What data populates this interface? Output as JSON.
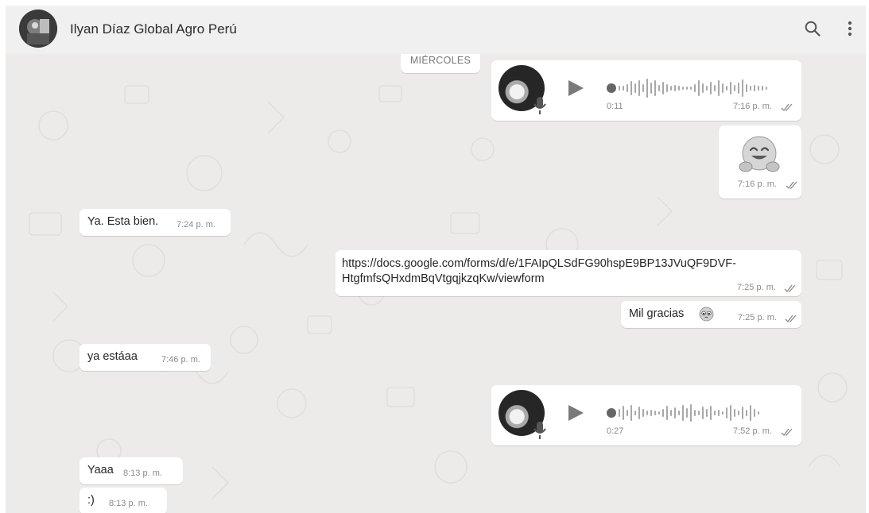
{
  "header": {
    "contact_name": "Ilyan Díaz Global Agro Perú",
    "search_icon": "search-icon",
    "menu_icon": "kebab-menu-icon"
  },
  "chat": {
    "date_separator": "MIÉRCOLES",
    "messages": [
      {
        "type": "voice",
        "direction": "out",
        "duration": "0:11",
        "time": "7:16 p. m.",
        "status": "read"
      },
      {
        "type": "sticker",
        "direction": "out",
        "sticker": "hugging-face-emoji",
        "time": "7:16 p. m.",
        "status": "read"
      },
      {
        "type": "text",
        "direction": "in",
        "text": "Ya. Esta bien.",
        "time": "7:24 p. m."
      },
      {
        "type": "text",
        "direction": "out",
        "text_line1": "https://docs.google.com/forms/d/e/1FAIpQLSdFG90hspE9BP13JVuQF9DVF-",
        "text_line2": "HtgfmfsQHxdmBqVtgqjkzqKw/viewform",
        "time": "7:25 p. m.",
        "status": "read"
      },
      {
        "type": "text",
        "direction": "out",
        "text": "Mil gracias",
        "emoji": "pleading-face-emoji",
        "time": "7:25 p. m.",
        "status": "read"
      },
      {
        "type": "text",
        "direction": "in",
        "text": "ya estáaa",
        "time": "7:46 p. m."
      },
      {
        "type": "voice",
        "direction": "out",
        "duration": "0:27",
        "time": "7:52 p. m.",
        "status": "read"
      },
      {
        "type": "text",
        "direction": "in",
        "text": "Yaaa",
        "time": "8:13 p. m."
      },
      {
        "type": "text",
        "direction": "in",
        "text": ":)",
        "time": "8:13 p. m."
      }
    ]
  },
  "colors": {
    "chat_background": "#ecebea",
    "header_background": "#f0f0f0",
    "bubble": "#ffffff",
    "read_ticks": "#8a8a8a"
  }
}
